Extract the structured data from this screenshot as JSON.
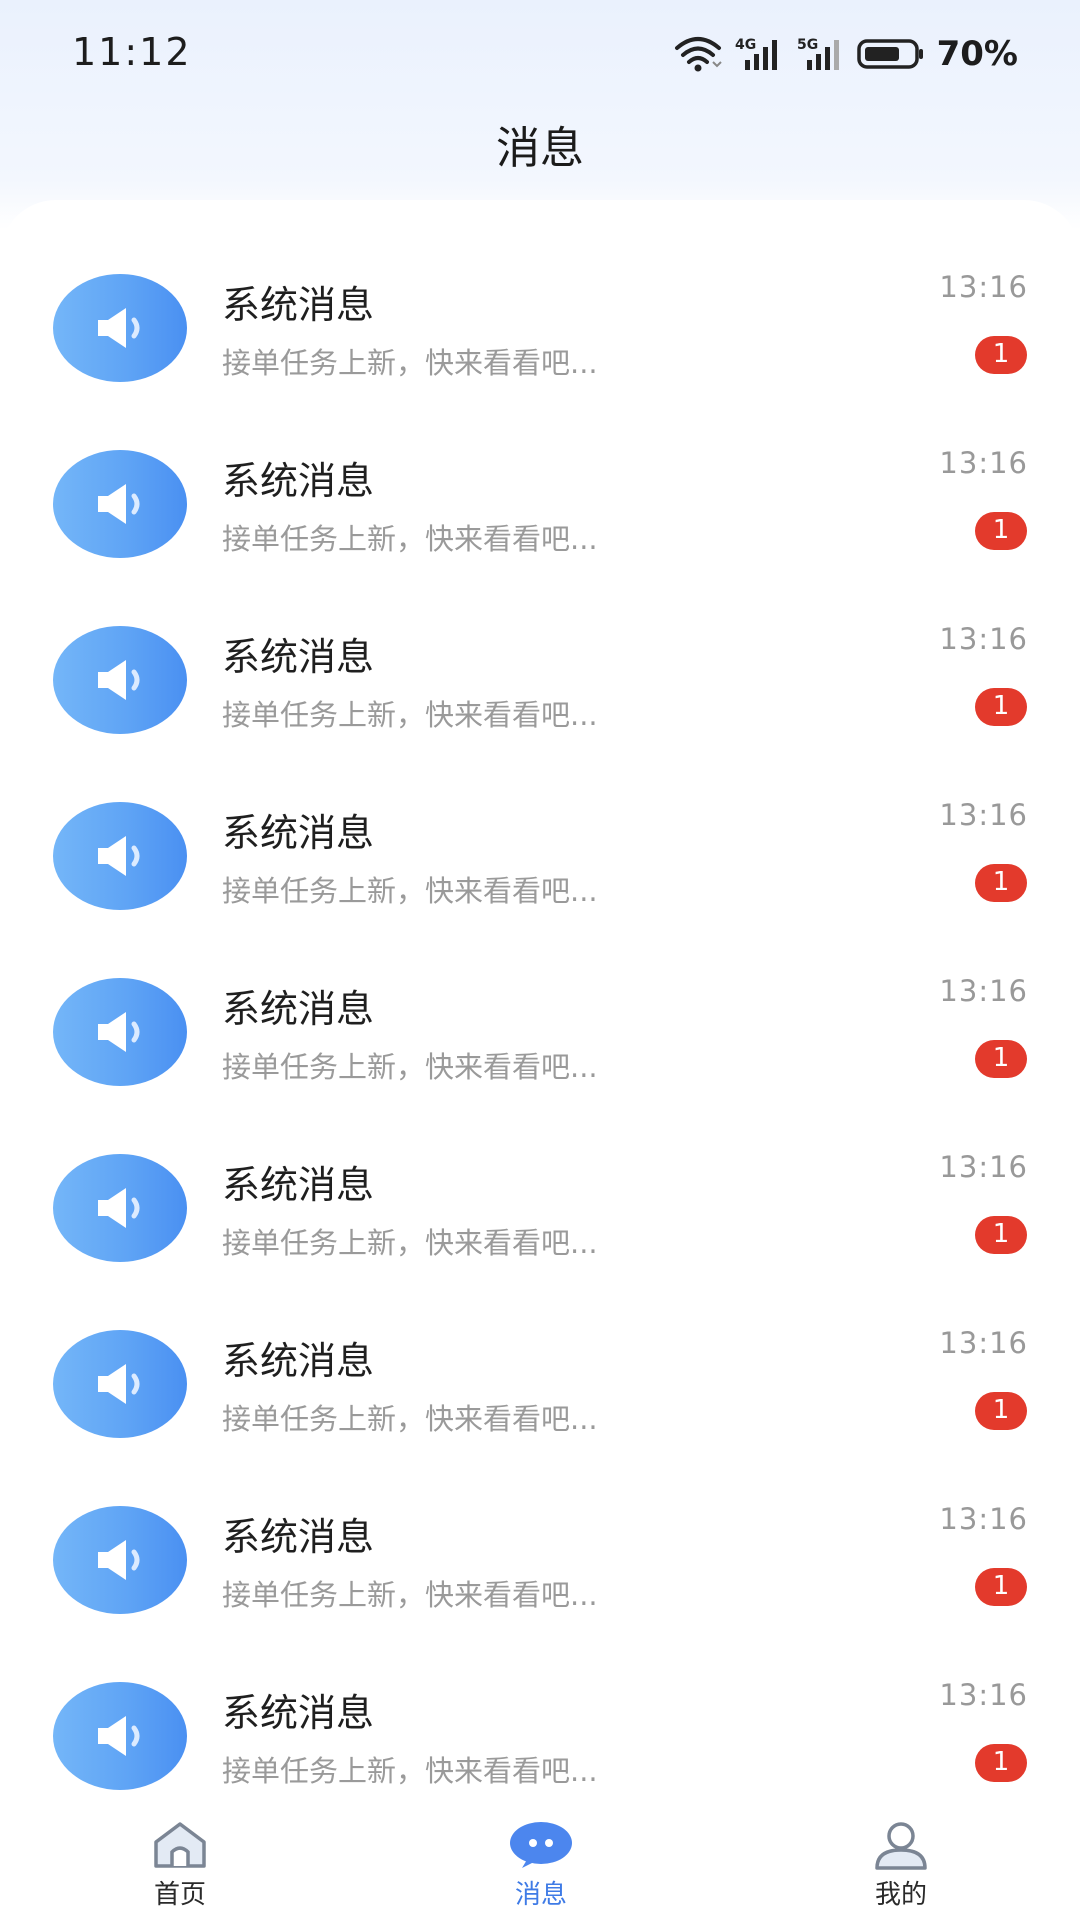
{
  "status_bar": {
    "time": "11:12",
    "network_1": "4G",
    "network_2": "5G",
    "battery": "70%",
    "icons": [
      "wifi-icon",
      "signal-4g-icon",
      "signal-5g-icon",
      "battery-icon"
    ]
  },
  "header": {
    "title": "消息"
  },
  "messages": [
    {
      "title": "系统消息",
      "preview": "接单任务上新，快来看看吧...",
      "time": "13:16",
      "unread": "1"
    },
    {
      "title": "系统消息",
      "preview": "接单任务上新，快来看看吧...",
      "time": "13:16",
      "unread": "1"
    },
    {
      "title": "系统消息",
      "preview": "接单任务上新，快来看看吧...",
      "time": "13:16",
      "unread": "1"
    },
    {
      "title": "系统消息",
      "preview": "接单任务上新，快来看看吧...",
      "time": "13:16",
      "unread": "1"
    },
    {
      "title": "系统消息",
      "preview": "接单任务上新，快来看看吧...",
      "time": "13:16",
      "unread": "1"
    },
    {
      "title": "系统消息",
      "preview": "接单任务上新，快来看看吧...",
      "time": "13:16",
      "unread": "1"
    },
    {
      "title": "系统消息",
      "preview": "接单任务上新，快来看看吧...",
      "time": "13:16",
      "unread": "1"
    },
    {
      "title": "系统消息",
      "preview": "接单任务上新，快来看看吧...",
      "time": "13:16",
      "unread": "1"
    },
    {
      "title": "系统消息",
      "preview": "接单任务上新，快来看看吧...",
      "time": "13:16",
      "unread": "1"
    }
  ],
  "tab_bar": {
    "tabs": [
      {
        "label": "首页",
        "icon": "home-icon",
        "active": false
      },
      {
        "label": "消息",
        "icon": "chat-bubble-icon",
        "active": true
      },
      {
        "label": "我的",
        "icon": "user-icon",
        "active": false
      }
    ]
  },
  "colors": {
    "accent": "#3F7BE6",
    "avatar_gradient_start": "#74B6F8",
    "avatar_gradient_end": "#4A90F2",
    "badge": "#E33A2C",
    "header_bg": "#EAF1FD"
  }
}
